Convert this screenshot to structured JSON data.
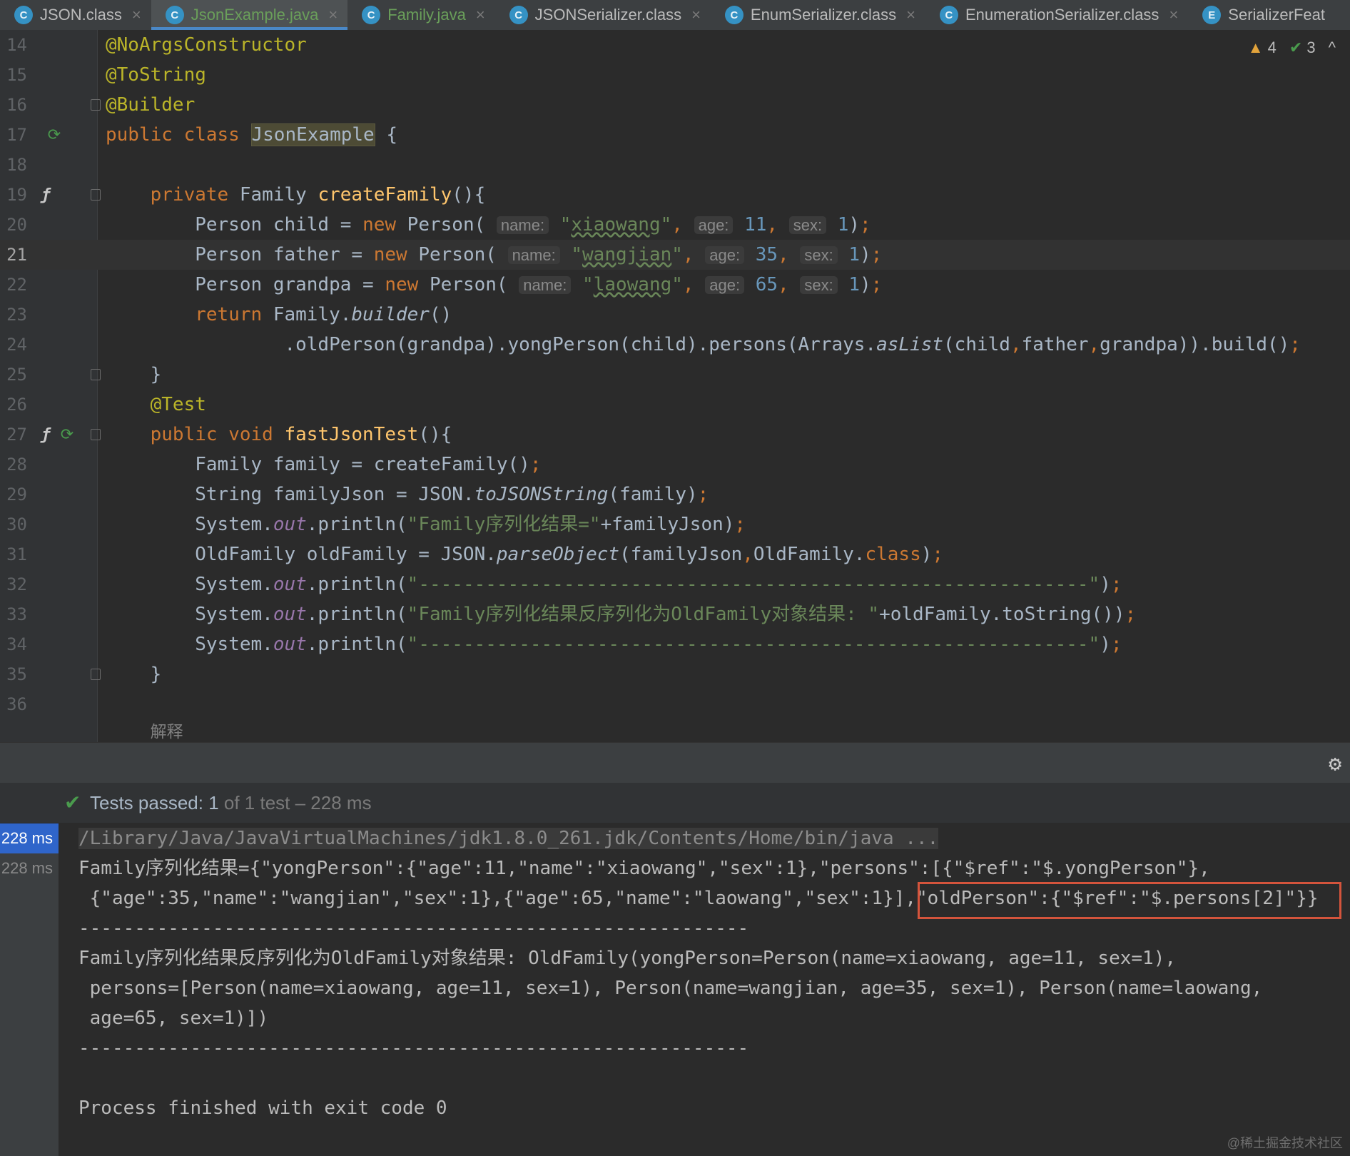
{
  "tabs": [
    {
      "label": "JSON.class",
      "icon": "C"
    },
    {
      "label": "JsonExample.java",
      "icon": "C"
    },
    {
      "label": "Family.java",
      "icon": "C"
    },
    {
      "label": "JSONSerializer.class",
      "icon": "C"
    },
    {
      "label": "EnumSerializer.class",
      "icon": "C"
    },
    {
      "label": "EnumerationSerializer.class",
      "icon": "C"
    },
    {
      "label": "SerializerFeat",
      "icon": "E"
    }
  ],
  "inspections": {
    "warnings": "4",
    "weak_warnings": "3"
  },
  "line_numbers": [
    "14",
    "15",
    "16",
    "17",
    "18",
    "19",
    "20",
    "21",
    "22",
    "23",
    "24",
    "25",
    "26",
    "27",
    "28",
    "29",
    "30",
    "31",
    "32",
    "33",
    "34",
    "35",
    "36"
  ],
  "code": {
    "l14": "@NoArgsConstructor",
    "l15": "@ToString",
    "l16": "@Builder",
    "l17_kw": "public class ",
    "l17_cls": "JsonExample",
    "l17_rest": " {",
    "l19_kw": "private ",
    "l19_type": "Family ",
    "l19_fn": "createFamily",
    "l19_rest": "(){",
    "persons": [
      {
        "var": "child",
        "name": "xiaowang",
        "age": "11",
        "sex": "1"
      },
      {
        "var": "father",
        "name": "wangjian",
        "age": "35",
        "sex": "1"
      },
      {
        "var": "grandpa",
        "name": "laowang",
        "age": "65",
        "sex": "1"
      }
    ],
    "hint_name": "name:",
    "hint_age": "age:",
    "hint_sex": "sex:",
    "l23_kw": "return ",
    "l23_a": "Family.",
    "l23_b": "builder",
    "l23_c": "()",
    "l24_a": ".oldPerson(grandpa).yongPerson(child).persons(Arrays.",
    "l24_b": "asList",
    "l24_c": "(child",
    "l24_d": "father",
    "l24_e": "grandpa)).build()",
    "l25": "}",
    "l26": "@Test",
    "l27_kw": "public void ",
    "l27_fn": "fastJsonTest",
    "l27_rest": "(){",
    "l28": "Family family = createFamily()",
    "l29_a": "String familyJson = JSON.",
    "l29_b": "toJSONString",
    "l29_c": "(family)",
    "l30_str": "\"Family序列化结果=\"",
    "l30_rest": "+familyJson)",
    "l31_a": "OldFamily oldFamily = JSON.",
    "l31_b": "parseObject",
    "l31_c": "(familyJson",
    "l31_d": "OldFamily.",
    "l31_e": "class",
    "l31_f": ")",
    "dash_str": "\"------------------------------------------------------------\"",
    "l33_str": "\"Family序列化结果反序列化为OldFamily对象结果: \"",
    "l33_rest": "+oldFamily.toString())",
    "sysout_a": "System.",
    "sysout_b": "out",
    "sysout_c": ".println(",
    "l35": "}",
    "comment_cn": "解释"
  },
  "test_status": {
    "label": "Tests passed: ",
    "count": "1",
    "rest": " of 1 test – 228 ms"
  },
  "test_times": [
    "228 ms",
    "228 ms"
  ],
  "console": {
    "cmd": "/Library/Java/JavaVirtualMachines/jdk1.8.0_261.jdk/Contents/Home/bin/java ...",
    "line1": "Family序列化结果={\"yongPerson\":{\"age\":11,\"name\":\"xiaowang\",\"sex\":1},\"persons\":[{\"$ref\":\"$.yongPerson\"},",
    "line2": " {\"age\":35,\"name\":\"wangjian\",\"sex\":1},{\"age\":65,\"name\":\"laowang\",\"sex\":1}],\"oldPerson\":{\"$ref\":\"$.persons[2]\"}}",
    "sep1": "------------------------------------------------------------",
    "line3": "Family序列化结果反序列化为OldFamily对象结果: OldFamily(yongPerson=Person(name=xiaowang, age=11, sex=1),",
    "line4": " persons=[Person(name=xiaowang, age=11, sex=1), Person(name=wangjian, age=35, sex=1), Person(name=laowang,",
    "line5": " age=65, sex=1)])",
    "sep2": "------------------------------------------------------------",
    "exit": "Process finished with exit code 0"
  },
  "watermark": "@稀土掘金技术社区",
  "colors": {
    "keyword": "#cc7832",
    "annotation": "#bbb529",
    "string": "#6a8759",
    "number": "#6897bb",
    "function": "#ffc66d",
    "highlight_box": "#d4543c",
    "test_pass": "#4a9b4d"
  }
}
